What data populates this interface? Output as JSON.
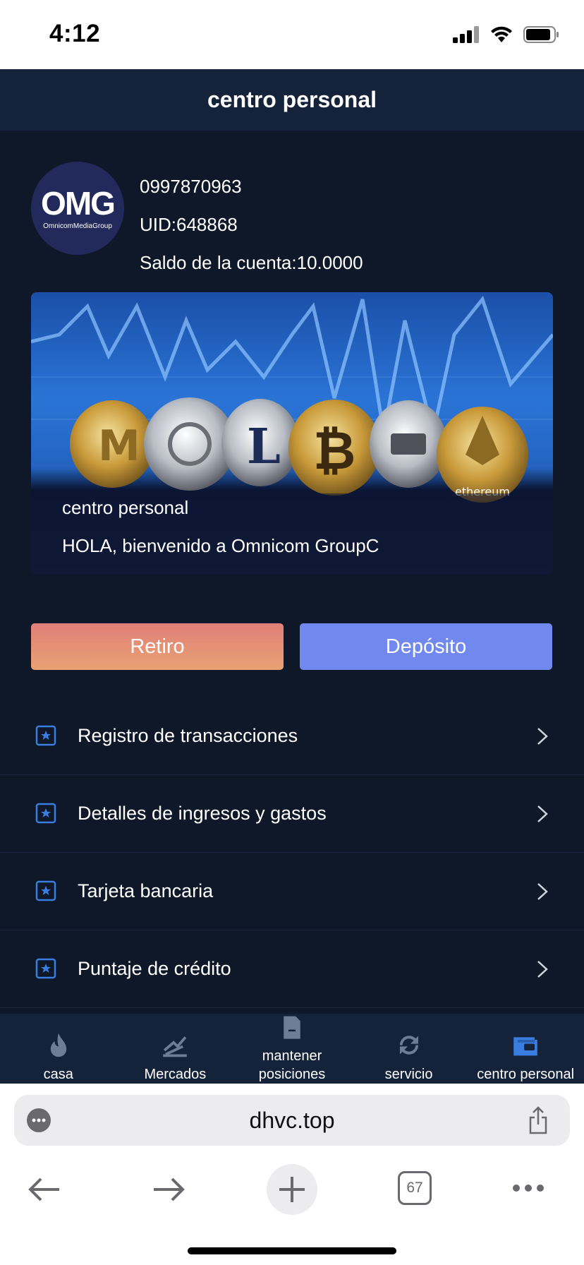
{
  "status_bar": {
    "time": "4:12"
  },
  "header": {
    "title": "centro personal"
  },
  "profile": {
    "avatar_mark": "OMG",
    "avatar_sub": "OmnicomMediaGroup",
    "phone": "0997870963",
    "uid": "UID:648868",
    "balance": "Saldo de la cuenta:10.0000"
  },
  "banner": {
    "coin_label": "ethereum",
    "title": "centro personal",
    "welcome": "HOLA, bienvenido a Omnicom GroupC"
  },
  "actions": {
    "withdraw": "Retiro",
    "deposit": "Depósito"
  },
  "menu": [
    {
      "label": "Registro de transacciones",
      "icon": "star-square-icon"
    },
    {
      "label": "Detalles de ingresos y gastos",
      "icon": "star-square-icon"
    },
    {
      "label": "Tarjeta bancaria",
      "icon": "star-square-icon"
    },
    {
      "label": "Puntaje de crédito",
      "icon": "star-square-icon"
    }
  ],
  "tabs": [
    {
      "label": "casa",
      "icon": "flame-icon",
      "active": false
    },
    {
      "label": "Mercados",
      "icon": "chart-icon",
      "active": false
    },
    {
      "label": "mantener posiciones",
      "icon": "document-icon",
      "active": false
    },
    {
      "label": "servicio",
      "icon": "refresh-icon",
      "active": false
    },
    {
      "label": "centro personal",
      "icon": "wallet-icon",
      "active": true
    }
  ],
  "browser": {
    "url": "dhvc.top",
    "tab_count": "67"
  },
  "colors": {
    "app_bg": "#0f1829",
    "header_bg": "#15233a",
    "accent": "#3a7de0",
    "withdraw": "#e38c76",
    "deposit": "#7189ef"
  }
}
